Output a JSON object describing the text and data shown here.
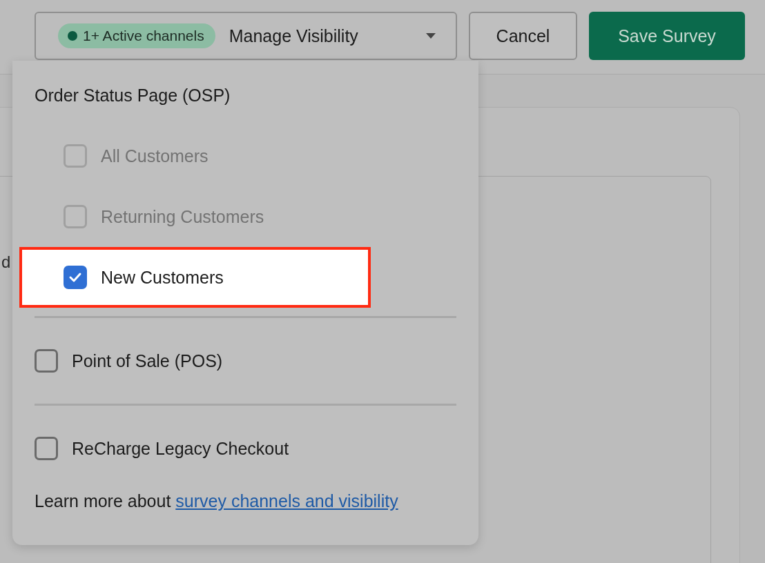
{
  "toolbar": {
    "visibility_button": {
      "badge": "1+ Active channels",
      "label": "Manage Visibility"
    },
    "buttons": [
      {
        "label": "Cancel",
        "kind": "secondary"
      },
      {
        "label": "Save Survey",
        "kind": "primary"
      }
    ]
  },
  "background_text": "d",
  "popover": {
    "items": [
      {
        "kind": "group",
        "title": "Order Status Page (OSP)",
        "children": [
          {
            "label": "All Customers",
            "checked": false,
            "disabled": true,
            "highlighted": false
          },
          {
            "label": "Returning Customers",
            "checked": false,
            "disabled": true,
            "highlighted": false
          },
          {
            "label": "New Customers",
            "checked": true,
            "disabled": false,
            "highlighted": true
          }
        ]
      },
      {
        "kind": "checkbox",
        "label": "Point of Sale (POS)",
        "checked": false,
        "disabled": false
      },
      {
        "kind": "checkbox",
        "label": "ReCharge Legacy Checkout",
        "checked": false,
        "disabled": false
      }
    ],
    "footer": {
      "text": "Learn more about ",
      "link": "survey channels and visibility"
    }
  }
}
